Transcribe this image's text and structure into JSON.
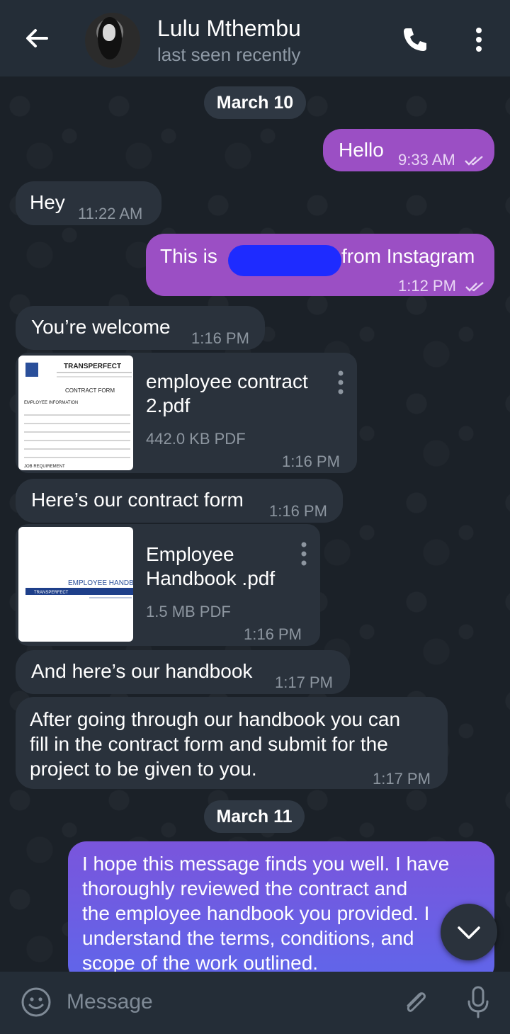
{
  "header": {
    "contact_name": "Lulu Mthembu",
    "status": "last seen recently"
  },
  "chat": {
    "date_1": "March 10",
    "date_2": "March 11",
    "messages": [
      {
        "text": "Hello",
        "time": "9:33 AM"
      },
      {
        "text": "Hey",
        "time": "11:22 AM"
      },
      {
        "text_left": "This is",
        "text_right": "from Instagram",
        "time": "1:12 PM"
      },
      {
        "text": "You’re welcome",
        "time": "1:16 PM"
      },
      {
        "file_name_1": "employee contract",
        "file_name_2": "2.pdf",
        "size": "442.0 KB PDF",
        "time": "1:16 PM",
        "thumb": {
          "brand": "TRANSPERFECT",
          "form": "CONTRACT FORM",
          "section": "EMPLOYEE INFORMATION",
          "footer": "JOB REQUIREMENT"
        }
      },
      {
        "text": "Here’s our contract form",
        "time": "1:16 PM"
      },
      {
        "file_name_1": "Employee",
        "file_name_2": "Handbook .pdf",
        "size": "1.5 MB PDF",
        "time": "1:16 PM",
        "thumb": {
          "title": "EMPLOYEE HANDB",
          "brand": "TRANSPERFECT"
        }
      },
      {
        "text": "And here’s our handbook",
        "time": "1:17 PM"
      },
      {
        "line_1": "After going through our handbook you can",
        "line_2": "fill in the contract form and submit for the",
        "line_3": "project to be given to you.",
        "time": "1:17 PM"
      },
      {
        "line_1": "I hope this message finds you well. I have",
        "line_2": "thoroughly reviewed the contract and",
        "line_3": "the employee handbook you provided. I",
        "line_4": "understand the terms, conditions, and",
        "line_5": "scope of the work outlined."
      }
    ]
  },
  "composer": {
    "placeholder": "Message"
  },
  "colors": {
    "accent_out": "#9b4fc4",
    "accent_out_new": "#6a5ce0",
    "bubble_in": "#2a323c",
    "header_bg": "#242d37"
  }
}
